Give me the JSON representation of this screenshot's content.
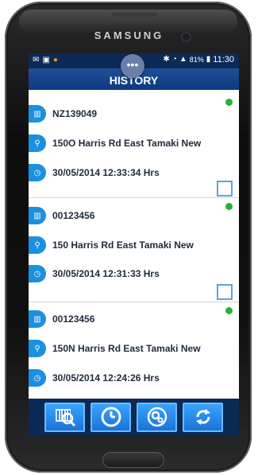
{
  "device": {
    "brand": "SAMSUNG"
  },
  "status_bar": {
    "battery": "81%",
    "time": "11:30"
  },
  "app": {
    "title": "HISTORY"
  },
  "history": [
    {
      "code": "NZ139049",
      "address": "150O Harris Rd East Tamaki New",
      "datetime": "30/05/2014 12:33:34 Hrs"
    },
    {
      "code": "00123456",
      "address": "150 Harris Rd East Tamaki New",
      "datetime": "30/05/2014 12:31:33 Hrs"
    },
    {
      "code": "00123456",
      "address": "150N Harris Rd East Tamaki New",
      "datetime": "30/05/2014 12:24:26 Hrs"
    }
  ],
  "toolbar": {
    "buttons": [
      "scan",
      "history",
      "settings",
      "sync"
    ]
  },
  "colors": {
    "accent": "#1b8fe0",
    "header": "#0c3a80",
    "status_dot": "#1fb43a"
  }
}
